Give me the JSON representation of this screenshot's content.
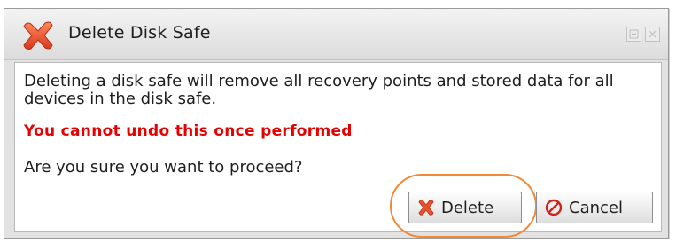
{
  "dialog": {
    "title": "Delete Disk Safe",
    "title_icon": "red-x-icon",
    "window_controls": [
      "restore-icon",
      "close-icon"
    ],
    "message": "Deleting a disk safe will remove all recovery points and stored data for all devices in the disk safe.",
    "warning": "You cannot undo this once performed",
    "question": "Are you sure you want to proceed?",
    "buttons": {
      "delete": {
        "label": "Delete",
        "icon": "red-x-icon"
      },
      "cancel": {
        "label": "Cancel",
        "icon": "no-entry-icon"
      }
    },
    "highlighted_button": "delete"
  },
  "colors": {
    "warning_text": "#e60000",
    "highlight_ring": "#f08a3a",
    "title_icon": "#e8532b"
  }
}
